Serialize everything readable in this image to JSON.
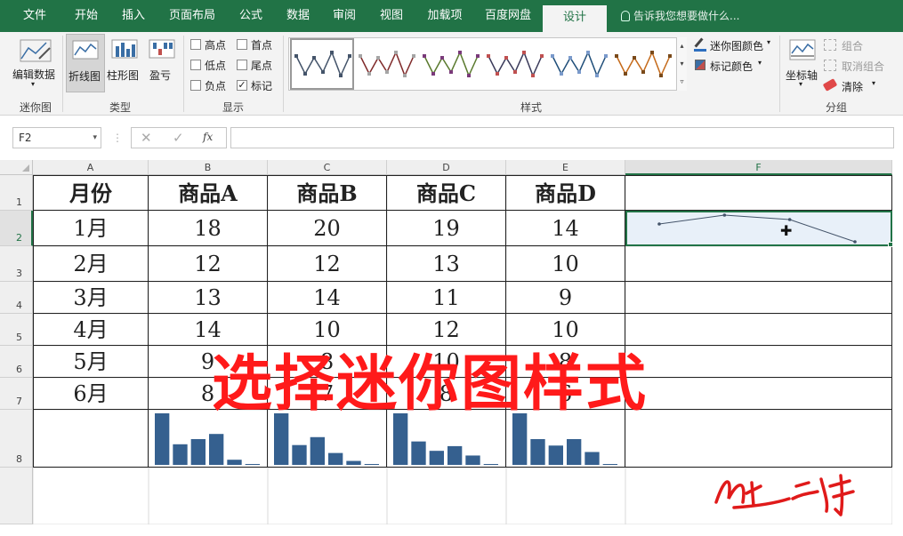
{
  "ribbon_tabs": [
    "文件",
    "开始",
    "插入",
    "页面布局",
    "公式",
    "数据",
    "审阅",
    "视图",
    "加载项",
    "百度网盘",
    "设计"
  ],
  "tell_me": "告诉我您想要做什么...",
  "groups": {
    "sparkline": {
      "label": "迷你图",
      "edit_data": "编辑数据"
    },
    "type": {
      "label": "类型",
      "line": "折线图",
      "column": "柱形图",
      "win_loss": "盈亏"
    },
    "show": {
      "label": "显示",
      "high": "高点",
      "low": "低点",
      "negative": "负点",
      "first": "首点",
      "last": "尾点",
      "markers": "标记",
      "markers_checked": "✓"
    },
    "style": {
      "label": "样式",
      "sparkline_color": "迷你图颜色",
      "marker_color": "标记颜色"
    },
    "group": {
      "label": "分组",
      "axis": "坐标轴",
      "group": "组合",
      "ungroup": "取消组合",
      "clear": "清除"
    }
  },
  "name_box": "F2",
  "fx": "fx",
  "columns": [
    "A",
    "B",
    "C",
    "D",
    "E",
    "F"
  ],
  "rows": [
    "1",
    "2",
    "3",
    "4",
    "5",
    "6",
    "7",
    "8"
  ],
  "table": {
    "header": [
      "月份",
      "商品A",
      "商品B",
      "商品C",
      "商品D"
    ],
    "body": [
      [
        "1月",
        "18",
        "20",
        "19",
        "14"
      ],
      [
        "2月",
        "12",
        "12",
        "13",
        "10"
      ],
      [
        "3月",
        "13",
        "14",
        "11",
        "9"
      ],
      [
        "4月",
        "14",
        "10",
        "12",
        "10"
      ],
      [
        "5月",
        "9",
        "8",
        "10",
        "8"
      ],
      [
        "6月",
        "8",
        "7",
        "8",
        "6"
      ]
    ]
  },
  "column_sparklines": [
    [
      18,
      12,
      13,
      14,
      9,
      8
    ],
    [
      20,
      12,
      14,
      10,
      8,
      7
    ],
    [
      19,
      13,
      11,
      12,
      10,
      8
    ],
    [
      14,
      10,
      9,
      10,
      8,
      6
    ]
  ],
  "line_sparkline": [
    18,
    20,
    19,
    14
  ],
  "overlay_text": "选择迷你图样式",
  "colors": {
    "accent": "#217346",
    "bar": "#35608f",
    "overlay": "#ff1a1a"
  }
}
